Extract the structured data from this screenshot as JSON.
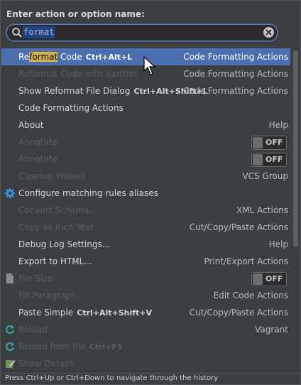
{
  "prompt": {
    "label": "Enter action or option name:"
  },
  "search": {
    "value": "format"
  },
  "rows": [
    {
      "pre": "Re",
      "hl": "format",
      "post": " Code",
      "shortcut": "Ctrl+Alt+L",
      "group": "Code Formatting Actions",
      "state": "selected"
    },
    {
      "name": "Reformat Code with dartfmt",
      "group": "Code Formatting Actions",
      "state": "disabled"
    },
    {
      "name": "Show Reformat File Dialog",
      "shortcut": "Ctrl+Alt+Shift+L",
      "group": "Code Formatting Actions",
      "state": "normal"
    },
    {
      "name": "Code Formatting Actions",
      "group": "",
      "state": "normal"
    },
    {
      "name": "About",
      "group": "Help",
      "state": "normal"
    },
    {
      "name": "Annotate",
      "toggle": "OFF",
      "state": "disabled"
    },
    {
      "name": "Annotate",
      "toggle": "OFF",
      "state": "disabled"
    },
    {
      "name": "Cleanup Project",
      "group": "VCS Group",
      "state": "disabled"
    },
    {
      "name": "Configure matching rules aliases",
      "group": "",
      "icon": "gear-icon",
      "state": "normal"
    },
    {
      "name": "Convert Schema...",
      "group": "XML Actions",
      "state": "disabled"
    },
    {
      "name": "Copy as Rich Text",
      "group": "Cut/Copy/Paste Actions",
      "state": "disabled"
    },
    {
      "name": "Debug Log Settings...",
      "group": "Help",
      "state": "normal"
    },
    {
      "name": "Export to HTML...",
      "group": "Print/Export Actions",
      "state": "normal"
    },
    {
      "name": "File Size",
      "toggle": "OFF",
      "icon": "file-icon",
      "state": "disabled"
    },
    {
      "name": "Fill Paragraph",
      "group": "Edit Code Actions",
      "state": "disabled"
    },
    {
      "name": "Paste Simple",
      "shortcut": "Ctrl+Alt+Shift+V",
      "group": "Cut/Copy/Paste Actions",
      "state": "normal"
    },
    {
      "name": "Reload",
      "group": "Vagrant",
      "icon": "reload-icon",
      "state": "disabled"
    },
    {
      "name": "Reload from file",
      "shortcut": "Ctrl+F5",
      "group": "",
      "icon": "reload-icon",
      "state": "disabled"
    },
    {
      "name": "Show Details",
      "group": "",
      "icon": "edit-icon",
      "state": "disabled"
    }
  ],
  "hint": "Press Ctrl+Up or Ctrl+Down to navigate through the history",
  "colors": {
    "selection": "#4b6eaf",
    "background": "#3c3f41",
    "match_highlight": "#d8b34a"
  }
}
